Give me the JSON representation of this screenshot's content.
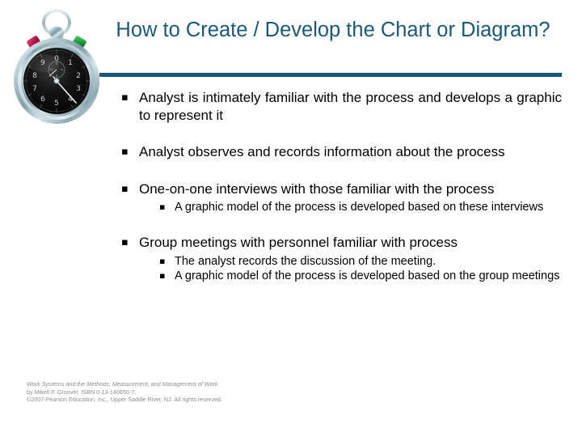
{
  "slide": {
    "title": "How to Create / Develop the Chart or Diagram?",
    "bullet_marker": "▪",
    "sub_bullet_marker": "▪"
  },
  "graphic": {
    "name": "stopwatch",
    "dial_color": "#0d0d0d",
    "case_color": "#a9c3cc",
    "left_button_color": "#b3174a",
    "right_button_color": "#1f9a3c",
    "hand_color": "#f2f6f7"
  },
  "theme": {
    "title_color": "#1A5A78",
    "divider_color": "#18597B",
    "body_text_color": "#000000",
    "footer_text_color": "#8f8f8f",
    "background": "#ffffff"
  },
  "content": {
    "bullets": [
      {
        "text": "Analyst is intimately familiar with the process and develops a graphic to represent it",
        "sub": []
      },
      {
        "text": "Analyst observes and records information about the process",
        "sub": []
      },
      {
        "text": "One-on-one interviews with those familiar with the process",
        "sub": [
          "A graphic model of the process is developed based on these interviews"
        ]
      },
      {
        "text": "Group meetings with personnel familiar with process",
        "sub": [
          "The analyst records the discussion of the meeting.",
          "A graphic model of the process is developed based on the group meetings"
        ]
      }
    ]
  },
  "footer": {
    "line1": "Work Systems and the Methods, Measurement, and Management of Work",
    "line2": "by Mikell P. Groover. ISBN 0-13-140650-7.",
    "line3": "©2007 Pearson Education, Inc., Upper Saddle River, NJ.  All rights reserved."
  }
}
